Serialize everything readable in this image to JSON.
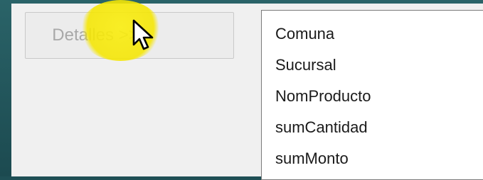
{
  "dialog": {
    "details_button_label": "Detalles >>"
  },
  "fields_list": {
    "items": [
      "Comuna",
      "Sucursal",
      "NomProducto",
      "sumCantidad",
      "sumMonto"
    ]
  },
  "pointer": {
    "icon": "arrow-cursor-icon",
    "highlight_color": "#f5e600"
  }
}
